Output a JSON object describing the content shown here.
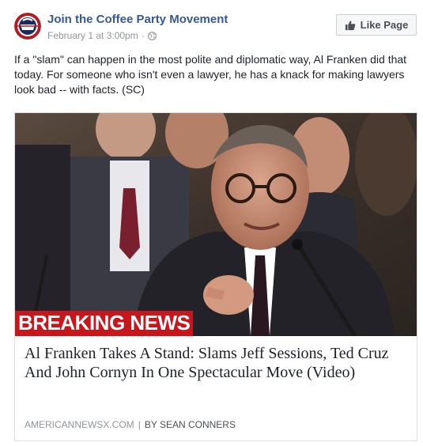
{
  "header": {
    "page_name": "Join the Coffee Party Movement",
    "timestamp": "February 1 at 3:00pm",
    "separator": "·",
    "audience_icon": "globe-icon",
    "like_button_label": "Like Page",
    "like_button_icon": "thumbs-up-icon"
  },
  "post": {
    "text": "If a \"slam\" can happen in the most polite and diplomatic way, Al Franken did that today. For someone who isn't even a lawyer, he has a knack for making lawyers look bad -- with facts. (SC)"
  },
  "link_card": {
    "image_banner": "BREAKING NEWS",
    "title": "Al Franken Takes A Stand: Slams Jeff Sessions, Ted Cruz And John Cornyn In One Spectacular Move (Video)",
    "domain": "AMERICANNEWSX.COM",
    "divider": "|",
    "author": "BY SEAN CONNERS"
  },
  "colors": {
    "link_blue": "#365899",
    "meta_gray": "#90949c",
    "banner_red": "#c8161d"
  }
}
